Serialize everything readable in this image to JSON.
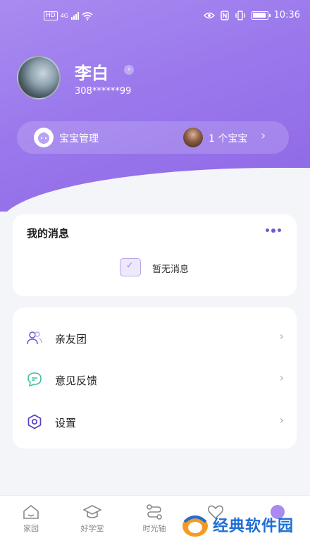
{
  "status_bar": {
    "hd_badge": "HD",
    "network": "4G",
    "time": "10:36"
  },
  "profile": {
    "name": "李白",
    "id_masked": "308******99"
  },
  "baby_bar": {
    "label": "宝宝管理",
    "count_text": "1 个宝宝"
  },
  "messages": {
    "title": "我的消息",
    "empty_text": "暂无消息"
  },
  "menu": [
    {
      "label": "亲友团",
      "icon": "people-icon"
    },
    {
      "label": "意见反馈",
      "icon": "feedback-icon"
    },
    {
      "label": "设置",
      "icon": "settings-icon"
    }
  ],
  "tabbar": [
    {
      "label": "家园",
      "icon": "home-icon"
    },
    {
      "label": "好学堂",
      "icon": "graduation-cap-icon"
    },
    {
      "label": "时光轴",
      "icon": "timeline-icon"
    },
    {
      "label": "",
      "icon": "heart-icon"
    },
    {
      "label": "",
      "icon": "profile-icon"
    }
  ],
  "watermark": {
    "text": "经典软件园"
  },
  "colors": {
    "hero_purple": "#9a78ec",
    "accent": "#7356d6",
    "feedback_green": "#3fbf9f",
    "background": "#f4f5f9"
  }
}
